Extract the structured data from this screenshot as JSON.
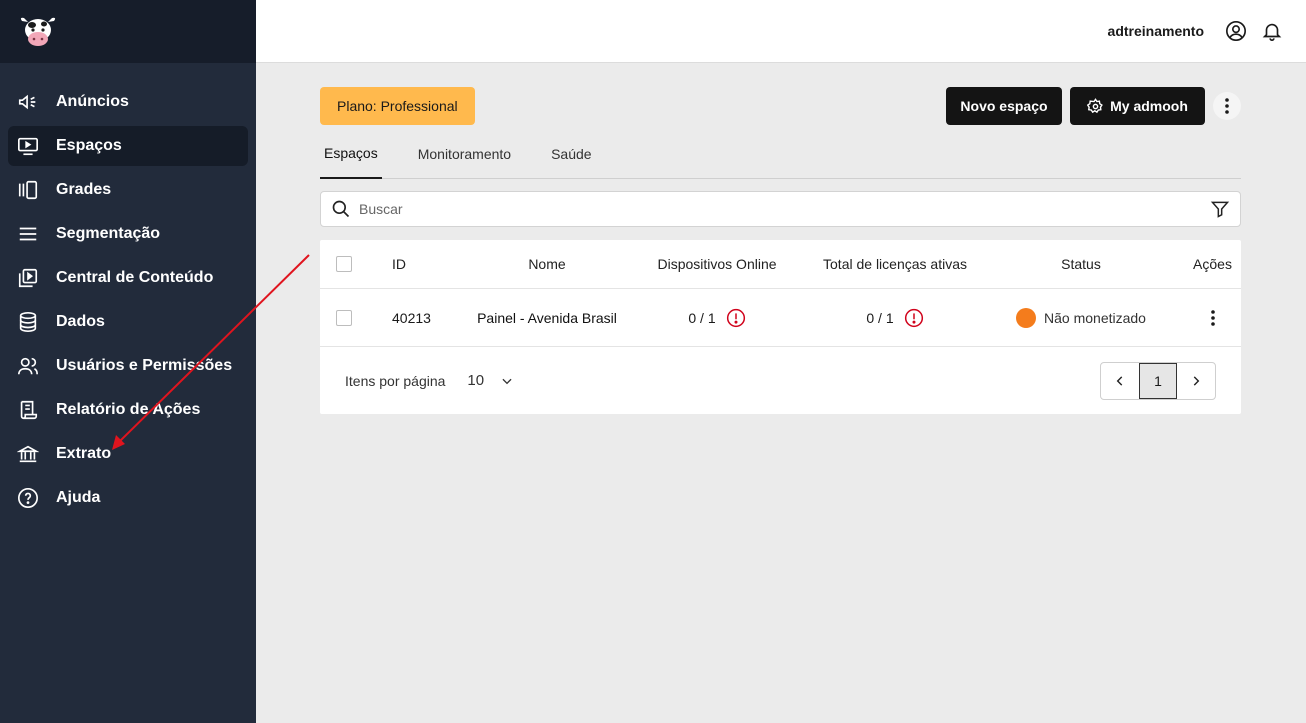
{
  "sidebar": {
    "items": [
      {
        "label": "Anúncios",
        "icon": "megaphone-icon"
      },
      {
        "label": "Espaços",
        "icon": "screen-play-icon",
        "active": true
      },
      {
        "label": "Grades",
        "icon": "panels-icon"
      },
      {
        "label": "Segmentação",
        "icon": "menu-lines-icon"
      },
      {
        "label": "Central de Conteúdo",
        "icon": "media-library-icon"
      },
      {
        "label": "Dados",
        "icon": "database-icon"
      },
      {
        "label": "Usuários e Permissões",
        "icon": "users-icon"
      },
      {
        "label": "Relatório de Ações",
        "icon": "report-icon"
      },
      {
        "label": "Extrato",
        "icon": "bank-icon"
      },
      {
        "label": "Ajuda",
        "icon": "help-icon"
      }
    ]
  },
  "header": {
    "username": "adtreinamento"
  },
  "main": {
    "plan_badge": "Plano: Professional",
    "new_space_label": "Novo espaço",
    "my_admooh_label": "My admooh",
    "tabs": [
      {
        "label": "Espaços",
        "active": true
      },
      {
        "label": "Monitoramento"
      },
      {
        "label": "Saúde"
      }
    ],
    "search_placeholder": "Buscar",
    "table": {
      "headers": {
        "id": "ID",
        "name": "Nome",
        "devices": "Dispositivos Online",
        "licenses": "Total de licenças ativas",
        "status": "Status",
        "actions": "Ações"
      },
      "rows": [
        {
          "id": "40213",
          "name": "Painel - Avenida Brasil",
          "devices": "0 / 1",
          "licenses": "0 / 1",
          "status": "Não monetizado",
          "status_color": "#f47c1c"
        }
      ]
    },
    "pagination": {
      "per_page_label": "Itens por página",
      "per_page_value": "10",
      "current_page": "1"
    }
  },
  "colors": {
    "sidebar": "#222b3b",
    "plan_badge": "#ffb94d",
    "alert": "#d0021b",
    "annotation_arrow": "#e0141e"
  }
}
